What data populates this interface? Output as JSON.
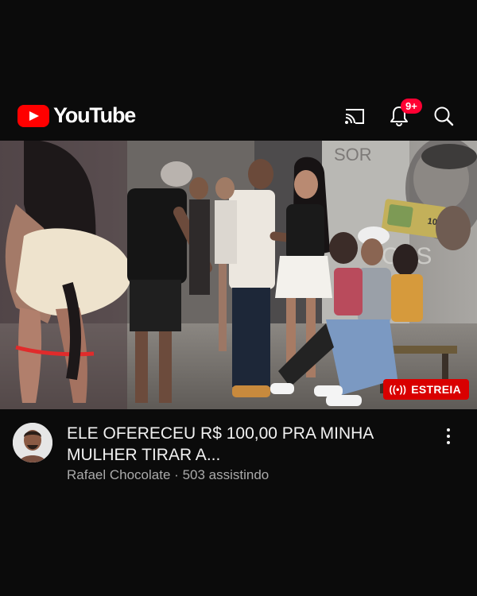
{
  "header": {
    "logo_text": "YouTube",
    "notification_count": "9+",
    "icons": [
      "cast-icon",
      "bell-icon",
      "search-icon"
    ]
  },
  "video": {
    "title": "ELE OFERECEU R$ 100,00 PRA MINHA MULHER TIRAR A...",
    "channel": "Rafael Chocolate",
    "separator": "·",
    "viewers": "503 assistindo",
    "premiere_label": "ESTREIA"
  },
  "thumbnail": {
    "banknote_value": "100",
    "storefront_text": "SOR",
    "window_text": "OSS"
  },
  "colors": {
    "brand_red": "#ff0000",
    "badge_red": "#ff0033",
    "premiere_red": "#d90000",
    "background": "#0b0b0b",
    "meta_text": "#aaaaaa"
  }
}
